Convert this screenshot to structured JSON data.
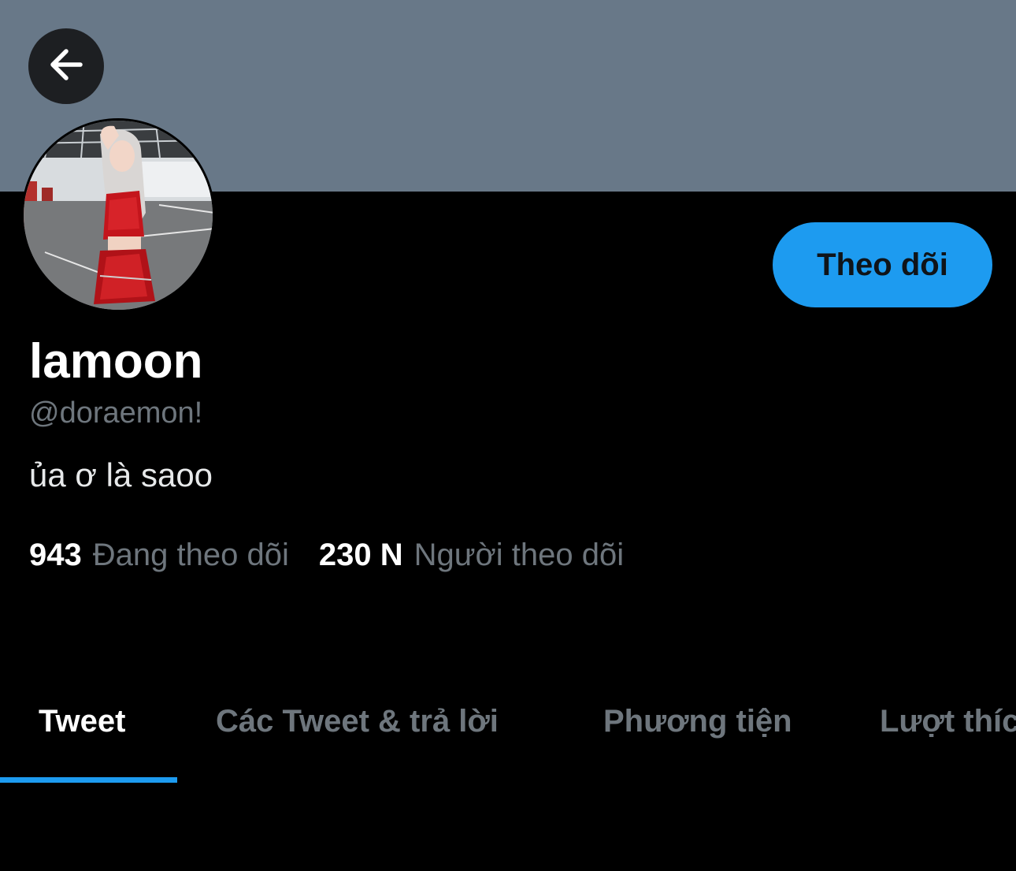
{
  "header": {
    "banner_color": "#687888",
    "back_icon": "arrow-left-icon"
  },
  "profile": {
    "avatar_icon": "profile-photo",
    "follow_label": "Theo dõi",
    "display_name": "lamoon",
    "handle": "@doraemon!",
    "bio": "ủa ơ là saoo",
    "following_count": "943",
    "following_label": "Đang theo dõi",
    "followers_count": "230 N",
    "followers_label": "Người theo dõi"
  },
  "tabs": [
    {
      "label": "Tweet",
      "active": true
    },
    {
      "label": "Các Tweet & trả lời",
      "active": false
    },
    {
      "label": "Phương tiện",
      "active": false
    },
    {
      "label": "Lượt thích",
      "active": false
    }
  ],
  "colors": {
    "accent": "#1d9bf0",
    "background": "#000000",
    "muted_text": "#6e767d"
  }
}
